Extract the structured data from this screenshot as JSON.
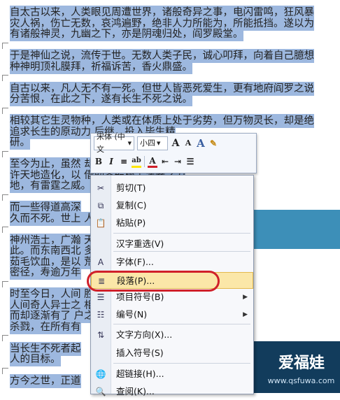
{
  "document": {
    "lines": [
      {
        "text": "自太古以来，人类眼见周遭世界，诸般奇异之事，电闪雷鸣，狂风暴",
        "sel": true
      },
      {
        "text": "灾人祸，伤亡无数，哀鸿遍野，绝非人力所能为，所能抵挡。遂以为",
        "sel": true
      },
      {
        "text": "有诸般神灵，九幽之下，亦是阴魂归处，阎罗殿堂。",
        "sel": true
      },
      {
        "text": "",
        "sel": false
      },
      {
        "text": "于是神仙之说，流传于世。无数人类子民，诚心叩拜，向着自己臆想",
        "sel": true
      },
      {
        "text": "种神明顶礼膜拜，祈福诉苦，香火鼎盛。",
        "sel": true
      },
      {
        "text": "",
        "sel": false
      },
      {
        "text": "自古以来，凡人无不有一死。但世人皆恶死爱生，更有地府阎罗之说",
        "sel": true
      },
      {
        "text": "分苦恨，在此之下，遂有长生不死之说。",
        "sel": true
      },
      {
        "text": "",
        "sel": false
      },
      {
        "text": "相较其它生灵物种，人类或在体质上处于劣势，但万物灵长，却是绝",
        "sel": true
      },
      {
        "text": "追求长生的原动力                              后继，投入毕生精",
        "sel": true
      },
      {
        "text": "研。",
        "sel": true
      },
      {
        "text": "",
        "sel": false
      },
      {
        "text": "至今为止，虽然                              却有一些修真炼道",
        "sel": true
      },
      {
        "text": "许天地造化，以                              借助各般秘宝法器之力",
        "sel": true
      },
      {
        "text": "地，有雷霆之威。",
        "sel": true
      },
      {
        "text": "",
        "sel": false
      },
      {
        "text": "而一些得道高深",
        "sel": true
      },
      {
        "text": "久而不死。世上                              人修真炼道之路。",
        "sel": true
      },
      {
        "text": "",
        "sel": false
      },
      {
        "text": "神州浩土，广瀚                              天下人口十之",
        "sel": true
      },
      {
        "text": "此。而东南西北                              多恶瘴毒物，亦多",
        "sel": true
      },
      {
        "text": "茹毛饮血，是以                              荒凉，残存人世",
        "sel": true
      },
      {
        "text": "密径，寿逾万年",
        "sel": true
      },
      {
        "text": "",
        "sel": false
      },
      {
        "text": "时至今日，人间                              胜数。又以神州东",
        "sel": true
      },
      {
        "text": "人间奇人异士之                              相同。长生之法还",
        "sel": true
      },
      {
        "text": "而却逐渐有了                                户之见，勾心斗",
        "sel": true
      },
      {
        "text": "杀戮，在所有有",
        "sel": true
      },
      {
        "text": "",
        "sel": false
      },
      {
        "text": "当长生不死者起",
        "sel": true
      },
      {
        "text": "人的目标。",
        "sel": true
      },
      {
        "text": "",
        "sel": false
      },
      {
        "text": "方今之世，正道",
        "sel": true
      }
    ]
  },
  "toolbar": {
    "font_name": "宋体 (中文",
    "font_size": "小四",
    "grow_font": "A",
    "shrink_font": "A",
    "style_a": "A",
    "bold": "B",
    "italic": "I",
    "align": "≡",
    "highlight": "ab",
    "font_color": "A",
    "indent_dec": "⇤",
    "indent_inc": "⇥",
    "bullets": "☰"
  },
  "menu": {
    "items": [
      {
        "label": "剪切(T)",
        "icon": "scissors-icon",
        "glyph": "✂",
        "arrow": ""
      },
      {
        "label": "复制(C)",
        "icon": "copy-icon",
        "glyph": "⧉",
        "arrow": ""
      },
      {
        "label": "粘贴(P)",
        "icon": "paste-icon",
        "glyph": "📋",
        "arrow": ""
      },
      {
        "label": "汉字重选(V)",
        "icon": "",
        "glyph": "",
        "arrow": ""
      },
      {
        "label": "字体(F)...",
        "icon": "font-icon",
        "glyph": "A",
        "arrow": ""
      },
      {
        "label": "段落(P)...",
        "icon": "paragraph-icon",
        "glyph": "≣",
        "arrow": ""
      },
      {
        "label": "项目符号(B)",
        "icon": "bullets-icon",
        "glyph": "☰",
        "arrow": "▶"
      },
      {
        "label": "编号(N)",
        "icon": "numbering-icon",
        "glyph": "☷",
        "arrow": "▶"
      },
      {
        "label": "文字方向(X)...",
        "icon": "text-direction-icon",
        "glyph": "⇅",
        "arrow": ""
      },
      {
        "label": "插入符号(S)",
        "icon": "",
        "glyph": "",
        "arrow": ""
      },
      {
        "label": "超链接(H)...",
        "icon": "hyperlink-icon",
        "glyph": "🌐",
        "arrow": ""
      },
      {
        "label": "查阅(K)...",
        "icon": "lookup-icon",
        "glyph": "🔍",
        "arrow": ""
      }
    ]
  },
  "watermark": {
    "text": "爱福娃",
    "sub": "www.qsfuwa.com"
  },
  "colors": {
    "selection": "#9db8df",
    "highlight_ring": "#d0202a",
    "menu_hover": "#fbe7a8"
  }
}
